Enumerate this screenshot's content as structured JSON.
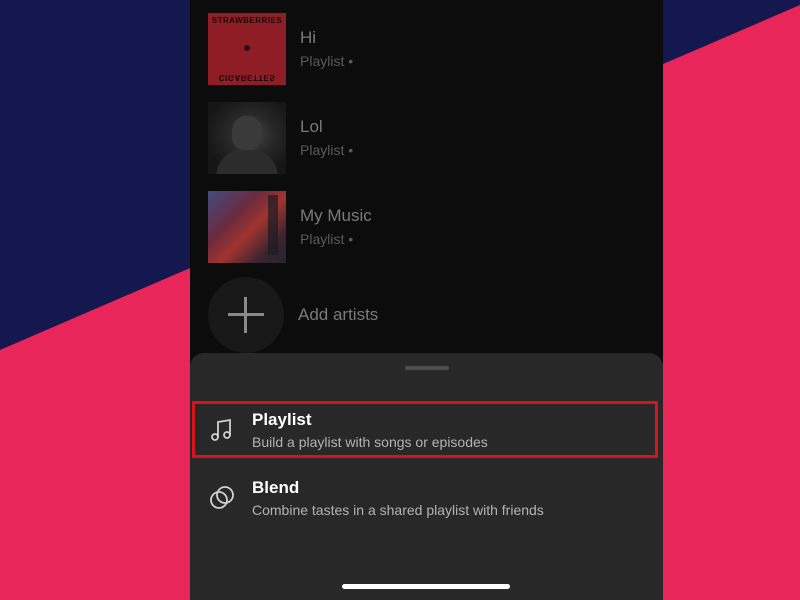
{
  "library": {
    "items": [
      {
        "title": "Hi",
        "subtitle": "Playlist •",
        "cover_top": "STRAWBERRIES",
        "cover_bottom": "CIGARETTES"
      },
      {
        "title": "Lol",
        "subtitle": "Playlist •"
      },
      {
        "title": "My Music",
        "subtitle": "Playlist •"
      }
    ],
    "add_artists": "Add artists"
  },
  "sheet": {
    "options": [
      {
        "title": "Playlist",
        "description": "Build a playlist with songs or episodes",
        "icon": "music-note-icon"
      },
      {
        "title": "Blend",
        "description": "Combine tastes in a shared playlist with friends",
        "icon": "blend-circles-icon"
      }
    ]
  },
  "colors": {
    "background_pink": "#e8265a",
    "background_navy": "#15184f",
    "sheet": "#282828",
    "highlight": "#d7131c"
  }
}
